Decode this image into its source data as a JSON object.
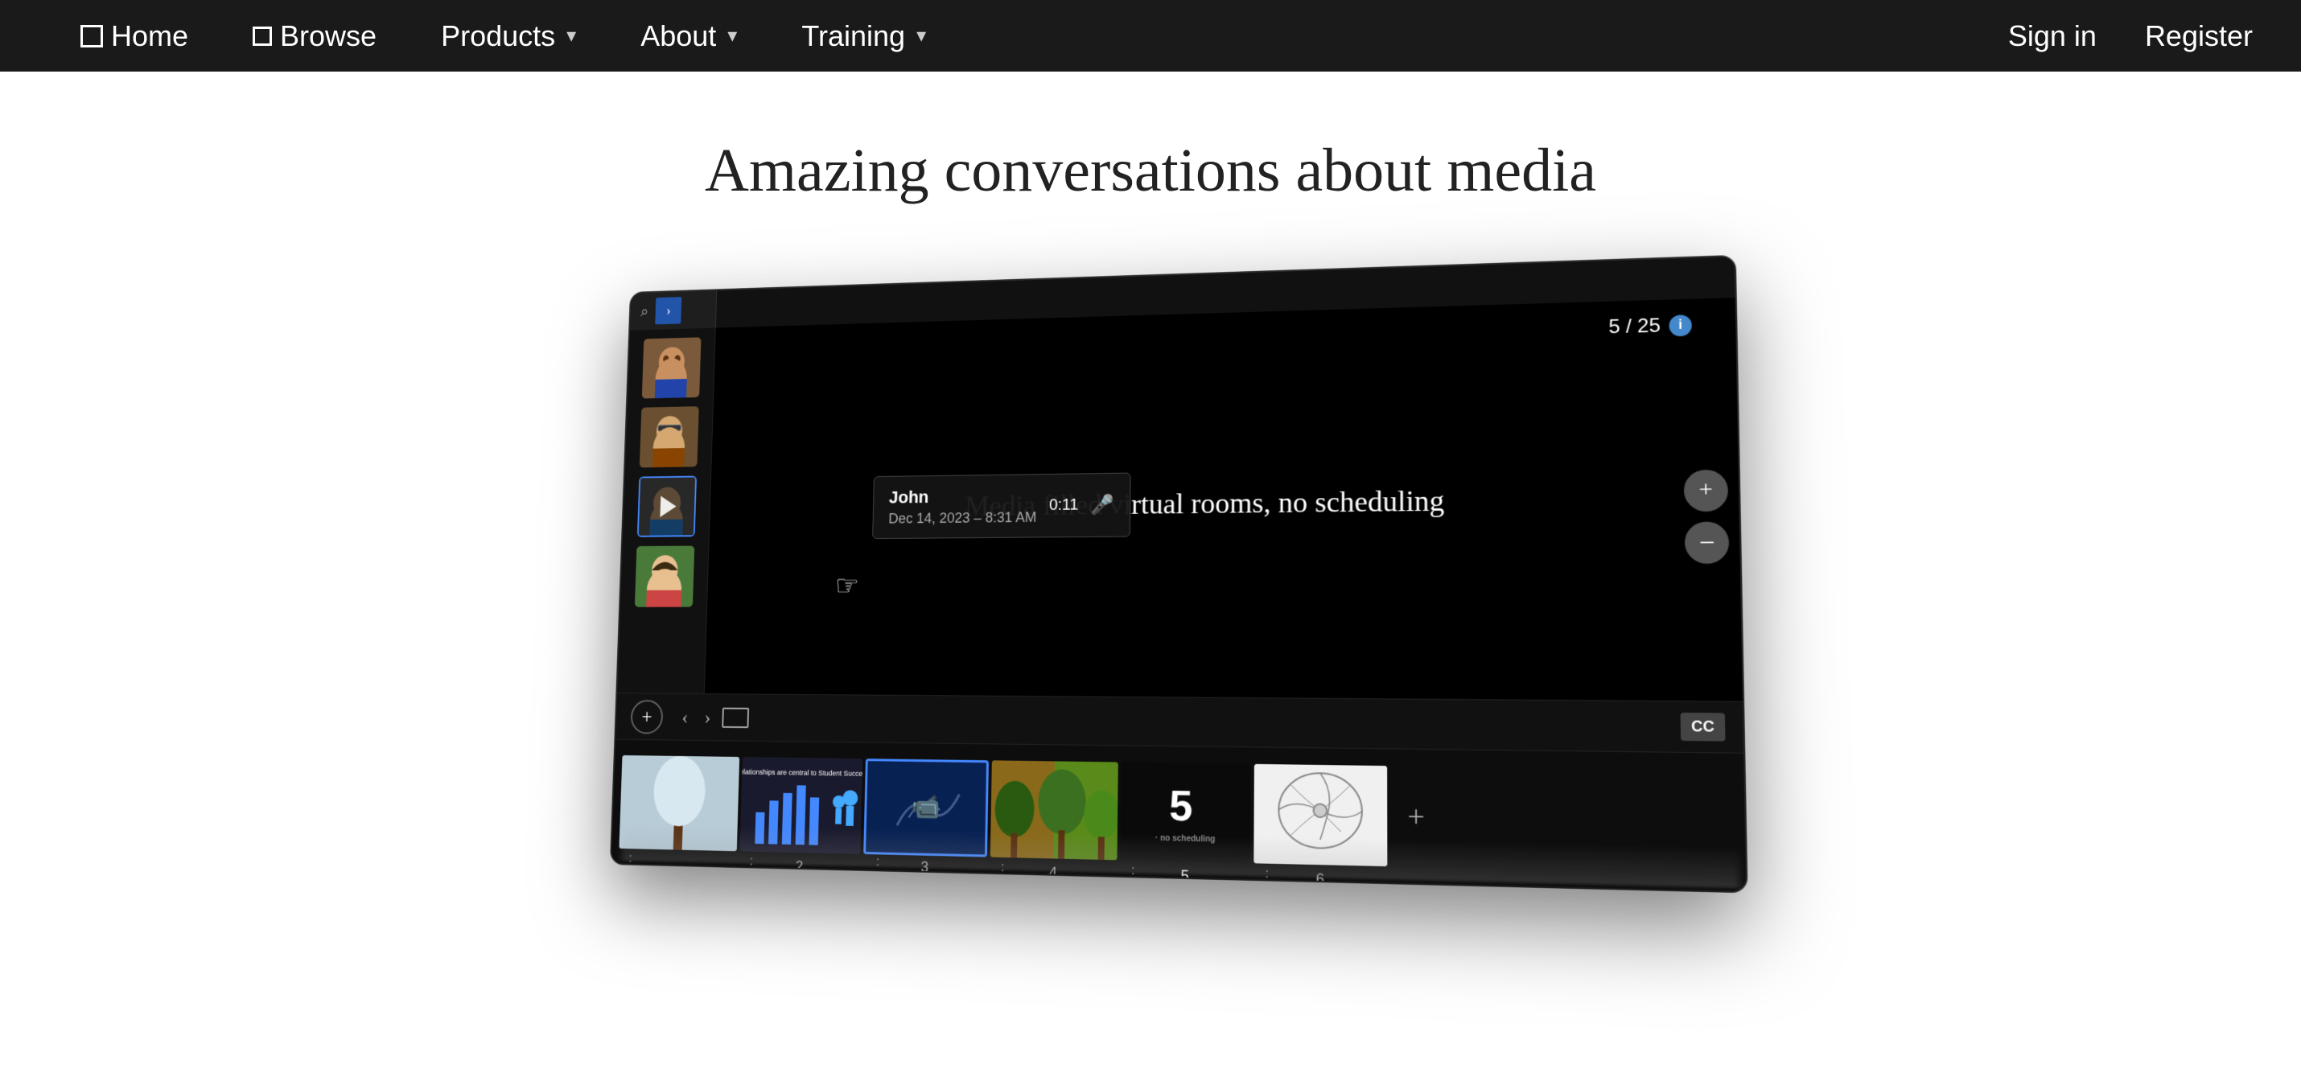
{
  "nav": {
    "home_label": "Home",
    "browse_label": "Browse",
    "products_label": "Products",
    "about_label": "About",
    "training_label": "Training",
    "signin_label": "Sign in",
    "register_label": "Register"
  },
  "main": {
    "title": "Amazing conversations about media"
  },
  "app": {
    "slide_counter": "5 / 25",
    "slide_text": "Media filled virtual rooms, no scheduling",
    "tooltip": {
      "name": "John",
      "date": "Dec 14, 2023 – 8:31 AM",
      "duration": "0:11"
    },
    "cc_label": "CC",
    "add_label": "+",
    "filmstrip": {
      "slides": [
        {
          "number": "",
          "type": "tree"
        },
        {
          "number": "2",
          "type": "chart"
        },
        {
          "number": "3",
          "type": "video"
        },
        {
          "number": "4",
          "type": "forest"
        },
        {
          "number": "5",
          "type": "dark-text"
        },
        {
          "number": "6",
          "type": "diagram"
        }
      ]
    }
  }
}
